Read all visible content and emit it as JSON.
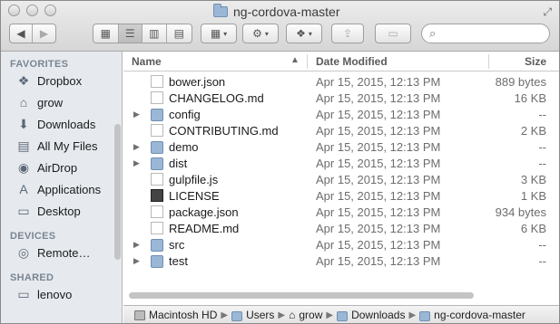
{
  "window": {
    "title": "ng-cordova-master"
  },
  "toolbar": {
    "back": "◀",
    "forward": "▶",
    "view_icon": "▦",
    "list_icon": "☰",
    "column_icon": "▥",
    "coverflow_icon": "▤",
    "arrange_icon": "▦",
    "action_icon": "⚙",
    "dropbox_icon": "❖",
    "share_icon": "⇪",
    "tag_icon": "▭",
    "search_placeholder": ""
  },
  "sidebar": {
    "favorites_header": "FAVORITES",
    "favorites": [
      {
        "label": "Dropbox",
        "icon": "❖"
      },
      {
        "label": "grow",
        "icon": "⌂"
      },
      {
        "label": "Downloads",
        "icon": "⬇"
      },
      {
        "label": "All My Files",
        "icon": "▤"
      },
      {
        "label": "AirDrop",
        "icon": "◉"
      },
      {
        "label": "Applications",
        "icon": "A"
      },
      {
        "label": "Desktop",
        "icon": "▭"
      }
    ],
    "devices_header": "DEVICES",
    "devices": [
      {
        "label": "Remote…",
        "icon": "◎"
      }
    ],
    "shared_header": "SHARED",
    "shared": [
      {
        "label": "lenovo",
        "icon": "▭"
      }
    ]
  },
  "columns": {
    "name": "Name",
    "date": "Date Modified",
    "size": "Size"
  },
  "files": [
    {
      "name": "bower.json",
      "date": "Apr 15, 2015, 12:13 PM",
      "size": "889 bytes",
      "type": "doc"
    },
    {
      "name": "CHANGELOG.md",
      "date": "Apr 15, 2015, 12:13 PM",
      "size": "16 KB",
      "type": "doc"
    },
    {
      "name": "config",
      "date": "Apr 15, 2015, 12:13 PM",
      "size": "--",
      "type": "folder"
    },
    {
      "name": "CONTRIBUTING.md",
      "date": "Apr 15, 2015, 12:13 PM",
      "size": "2 KB",
      "type": "doc"
    },
    {
      "name": "demo",
      "date": "Apr 15, 2015, 12:13 PM",
      "size": "--",
      "type": "folder"
    },
    {
      "name": "dist",
      "date": "Apr 15, 2015, 12:13 PM",
      "size": "--",
      "type": "folder"
    },
    {
      "name": "gulpfile.js",
      "date": "Apr 15, 2015, 12:13 PM",
      "size": "3 KB",
      "type": "js"
    },
    {
      "name": "LICENSE",
      "date": "Apr 15, 2015, 12:13 PM",
      "size": "1 KB",
      "type": "exec"
    },
    {
      "name": "package.json",
      "date": "Apr 15, 2015, 12:13 PM",
      "size": "934 bytes",
      "type": "doc"
    },
    {
      "name": "README.md",
      "date": "Apr 15, 2015, 12:13 PM",
      "size": "6 KB",
      "type": "doc"
    },
    {
      "name": "src",
      "date": "Apr 15, 2015, 12:13 PM",
      "size": "--",
      "type": "folder"
    },
    {
      "name": "test",
      "date": "Apr 15, 2015, 12:13 PM",
      "size": "--",
      "type": "folder"
    }
  ],
  "pathbar": [
    "Macintosh HD",
    "Users",
    "grow",
    "Downloads",
    "ng-cordova-master"
  ]
}
